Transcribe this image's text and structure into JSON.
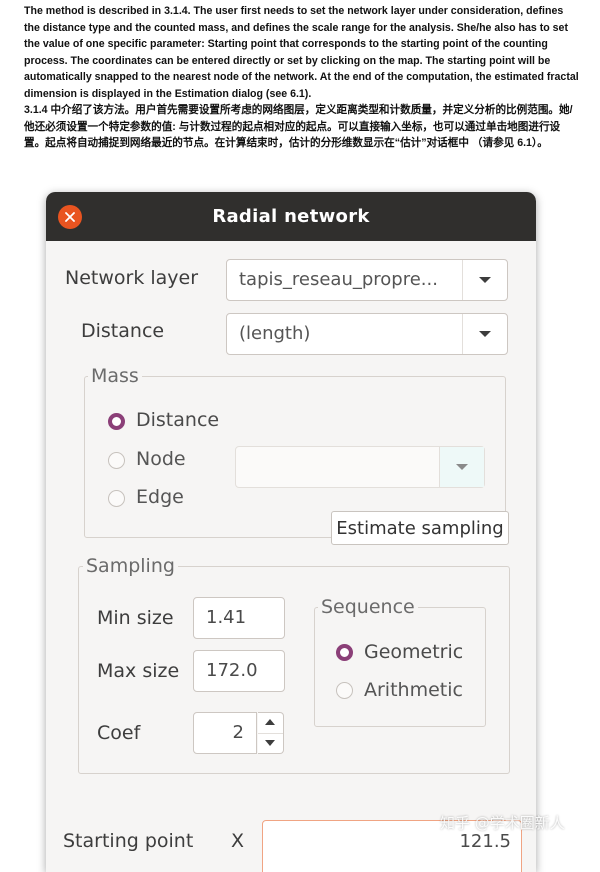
{
  "document": {
    "paragraph_en": "The method is described in 3.1.4. The user first needs to set the network layer under consideration, defines the distance type and the counted mass, and defines the scale range for the analysis. She/he also has to set the value of one specific parameter: Starting point that corresponds to the starting point of the counting process. The coordinates can be entered directly or set by clicking on the map. The starting point will be automatically snapped to the nearest node of the network. At the end of the computation, the estimated fractal dimension is displayed in the Estimation dialog (see 6.1).",
    "paragraph_zh": "3.1.4 中介绍了该方法。用户首先需要设置所考虑的网络图层，定义距离类型和计数质量，并定义分析的比例范围。她/他还必须设置一个特定参数的值: 与计数过程的起点相对应的起点。可以直接输入坐标，也可以通过单击地图进行设置。起点将自动捕捉到网络最近的节点。在计算结束时，估计的分形维数显示在“估计”对话框中 （请参见 6.1）。"
  },
  "dialog": {
    "title": "Radial network",
    "network_layer": {
      "label": "Network layer",
      "value": "tapis_reseau_propre..."
    },
    "distance": {
      "label": "Distance",
      "value": "(length)"
    },
    "mass": {
      "group_label": "Mass",
      "options": [
        "Distance",
        "Node",
        "Edge"
      ],
      "selected": "Distance",
      "combo_value": "",
      "tooltip": "Estimate sampling"
    },
    "sampling": {
      "group_label": "Sampling",
      "min_size_label": "Min size",
      "min_size_value": "1.41",
      "max_size_label": "Max size",
      "max_size_value": "172.0",
      "coef_label": "Coef",
      "coef_value": "2",
      "sequence": {
        "group_label": "Sequence",
        "options": [
          "Geometric",
          "Arithmetic"
        ],
        "selected": "Geometric"
      }
    },
    "starting_point": {
      "label": "Starting point",
      "x_label": "X",
      "x_value": "121.5"
    }
  },
  "watermark": "知乎 @学术圈新人",
  "colors": {
    "titlebar": "#302f2d",
    "close_button": "#e95420",
    "radio_selected": "#8b3f78",
    "dialog_background": "#f6f5f4",
    "focus_border": "#f0a483"
  }
}
